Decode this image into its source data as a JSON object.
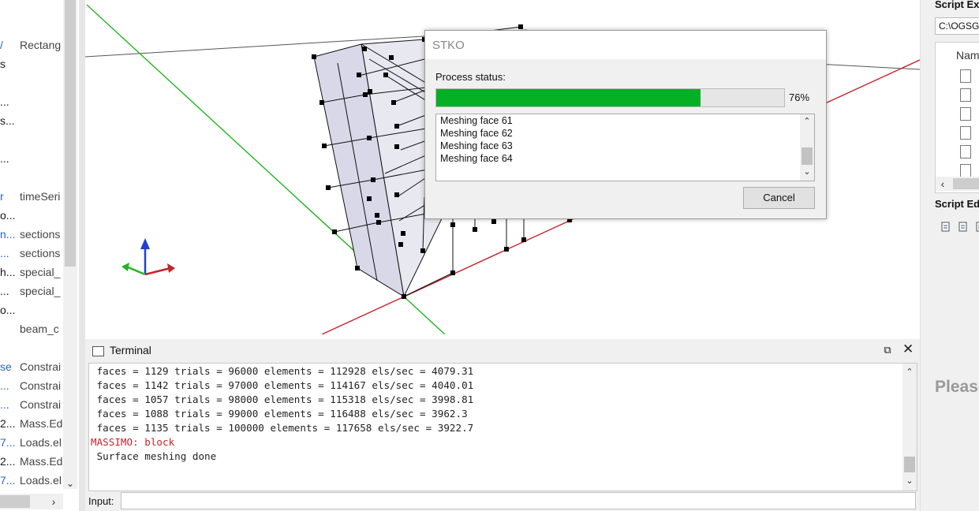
{
  "left_tree": {
    "rows": [
      {
        "c1": "/",
        "c2": "Rectang",
        "blue": true
      },
      {
        "c1": "s",
        "c2": "",
        "blue": false
      },
      {
        "c1": "",
        "c2": "",
        "blue": false
      },
      {
        "c1": "...",
        "c2": "",
        "blue": false
      },
      {
        "c1": "s...",
        "c2": "",
        "blue": false
      },
      {
        "c1": "",
        "c2": "",
        "blue": false
      },
      {
        "c1": "...",
        "c2": "",
        "blue": false
      },
      {
        "c1": "",
        "c2": "",
        "blue": false
      },
      {
        "c1": "r",
        "c2": "timeSeri",
        "blue": true
      },
      {
        "c1": "o...",
        "c2": "",
        "blue": false
      },
      {
        "c1": "n...",
        "c2": "sections",
        "blue": true
      },
      {
        "c1": "...",
        "c2": "sections",
        "blue": true
      },
      {
        "c1": "h...",
        "c2": "special_",
        "blue": false
      },
      {
        "c1": "...",
        "c2": "special_",
        "blue": false
      },
      {
        "c1": "o...",
        "c2": "",
        "blue": false
      },
      {
        "c1": "",
        "c2": "beam_c",
        "blue": false
      },
      {
        "c1": "",
        "c2": "",
        "blue": false
      },
      {
        "c1": "se",
        "c2": "Constrai",
        "blue": true
      },
      {
        "c1": "...",
        "c2": "Constrai",
        "blue": true
      },
      {
        "c1": "...",
        "c2": "Constrai",
        "blue": true
      },
      {
        "c1": "2...",
        "c2": "Mass.Ed",
        "blue": false
      },
      {
        "c1": "7...",
        "c2": "Loads.el",
        "blue": true
      },
      {
        "c1": "2...",
        "c2": "Mass.Ed",
        "blue": false
      },
      {
        "c1": "7...",
        "c2": "Loads.el",
        "blue": true
      }
    ],
    "down_arrow": "⌄",
    "right_arrow": "›"
  },
  "dialog": {
    "title": "STKO",
    "status_label": "Process status:",
    "progress_percent": 76,
    "progress_text": "76%",
    "log_lines": [
      "Meshing face 61",
      "Meshing face 62",
      "Meshing face 63",
      "Meshing face 64"
    ],
    "cancel_label": "Cancel",
    "scroll_up": "⌃",
    "scroll_down": "⌄"
  },
  "terminal": {
    "title": "Terminal",
    "float_glyph": "⧉",
    "close_glyph": "✕",
    "lines": [
      {
        "text": " faces = 1129 trials = 96000 elements = 112928 els/sec = 4079.31",
        "style": "normal"
      },
      {
        "text": " faces = 1142 trials = 97000 elements = 114167 els/sec = 4040.01",
        "style": "normal"
      },
      {
        "text": " faces = 1057 trials = 98000 elements = 115318 els/sec = 3998.81",
        "style": "normal"
      },
      {
        "text": " faces = 1088 trials = 99000 elements = 116488 els/sec = 3962.3",
        "style": "normal"
      },
      {
        "text": " faces = 1135 trials = 100000 elements = 117658 els/sec = 3922.7",
        "style": "normal"
      },
      {
        "text": "MASSIMO: block",
        "style": "red"
      },
      {
        "text": " Surface meshing done",
        "style": "normal"
      }
    ],
    "input_label": "Input:",
    "input_value": "",
    "scroll_up": "⌃",
    "scroll_down": "⌄"
  },
  "right_panel": {
    "script_explorer_title": "Script Ex",
    "path": "C:\\OGSG",
    "name_header": "Nam",
    "file_count": 6,
    "left_arrow": "‹",
    "script_editor_title": "Script Ed",
    "tool_icons": [
      "new-file-icon",
      "open-folder-icon",
      "save-icon"
    ],
    "placeholder_text": "Please"
  },
  "colors": {
    "progress_fill": "#06b025",
    "axis_x": "#c8222b",
    "axis_y": "#22b422",
    "axis_z": "#1f3fd6",
    "mesh_face": "#d8d8e8",
    "error_text": "#c8222b"
  }
}
